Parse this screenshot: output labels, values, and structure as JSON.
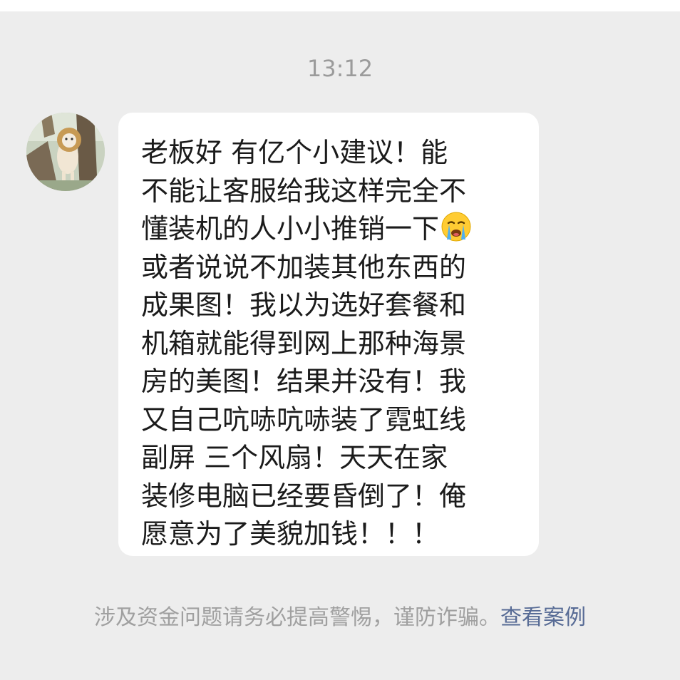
{
  "chat": {
    "timestamp": "13:12",
    "message": {
      "lines": [
        "老板好 有亿个小建议！能",
        "不能让客服给我这样完全不",
        "懂装机的人小小推销一下",
        "或者说说不加装其他东西的",
        "成果图！我以为选好套餐和",
        "机箱就能得到网上那种海景",
        "房的美图！结果并没有！我",
        "又自己吭哧吭哧装了霓虹线",
        "副屏 三个风扇！天天在家",
        "装修电脑已经要昏倒了！俺",
        "愿意为了美貌加钱！！！"
      ],
      "emoji": "crying-face"
    }
  },
  "footer": {
    "warning_text": "涉及资金问题请务必提高警惕，谨防诈骗。",
    "link_text": "查看案例"
  },
  "colors": {
    "background": "#ededed",
    "bubble": "#ffffff",
    "link": "#576b95",
    "muted_text": "#a0a0a0"
  }
}
